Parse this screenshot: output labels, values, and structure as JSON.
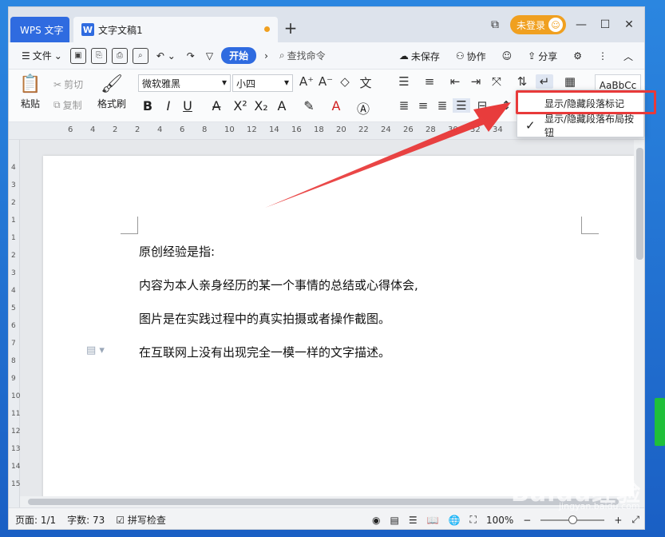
{
  "tabs": {
    "app": "WPS 文字",
    "doc": "文字文稿1",
    "doc_icon": "W",
    "new": "+"
  },
  "login": {
    "label": "未登录",
    "avatar": "☺"
  },
  "window_controls": {
    "layout": "⧉",
    "min": "—",
    "max": "☐",
    "close": "✕"
  },
  "menu": {
    "file": "文件",
    "start": "开始",
    "search": "查找命令",
    "unsaved": "未保存",
    "collab": "协作",
    "share": "分享"
  },
  "ribbon": {
    "paste": "粘贴",
    "cut": "剪切",
    "copy": "复制",
    "format_painter": "格式刷",
    "font": "微软雅黑",
    "size": "小四",
    "styles_preview": "AaBbCc"
  },
  "ruler_h": [
    "6",
    "4",
    "2",
    "2",
    "4",
    "6",
    "8",
    "10",
    "12",
    "14",
    "16",
    "18",
    "20",
    "22",
    "24",
    "26",
    "28",
    "30",
    "32",
    "34"
  ],
  "ruler_v": [
    "4",
    "3",
    "2",
    "1",
    "1",
    "2",
    "3",
    "4",
    "5",
    "6",
    "7",
    "8",
    "9",
    "10",
    "11",
    "12",
    "13",
    "14",
    "15"
  ],
  "document": {
    "lines": [
      "原创经验是指:",
      "内容为本人亲身经历的某一个事情的总结或心得体会,",
      "图片是在实践过程中的真实拍摄或者操作截图。",
      "在互联网上没有出现完全一模一样的文字描述。"
    ]
  },
  "dropdown": {
    "item1": "显示/隐藏段落标记",
    "item2": "显示/隐藏段落布局按钮",
    "check": "✓"
  },
  "status": {
    "page": "页面: 1/1",
    "words": "字数: 73",
    "spell": "拼写检查",
    "zoom": "100%",
    "zoom_level": 0.5,
    "minus": "−",
    "plus": "+"
  },
  "watermark": {
    "logo": "Baidu经验",
    "url": "jingyan.baidu.com"
  },
  "colors": {
    "accent": "#2f6be0",
    "login": "#f0a020",
    "highlight": "#e83a3a"
  }
}
